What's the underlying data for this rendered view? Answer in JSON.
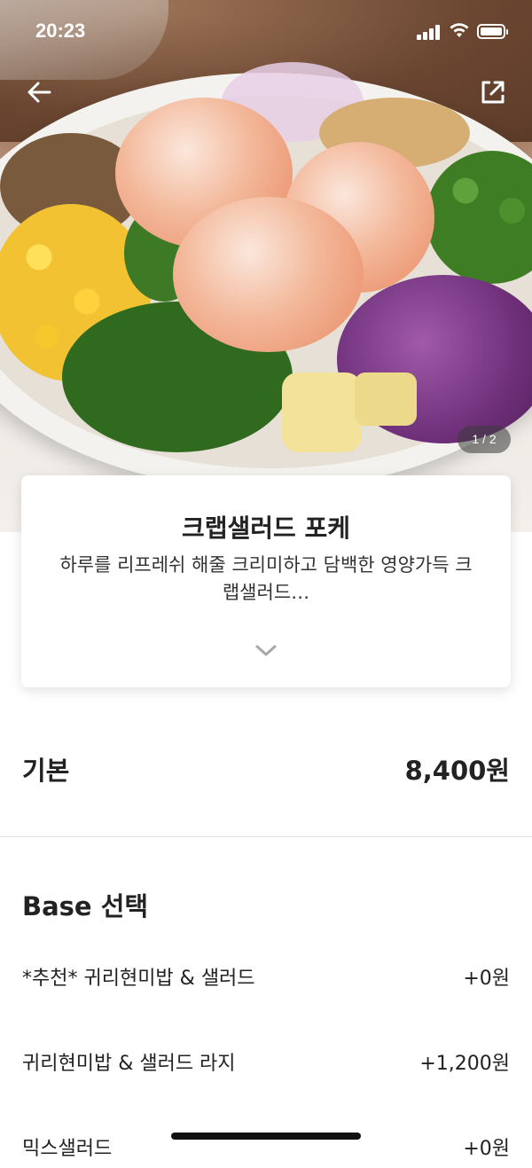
{
  "status_bar": {
    "time": "20:23"
  },
  "gallery": {
    "counter": "1 / 2"
  },
  "product": {
    "name": "크랩샐러드 포케",
    "description": "하루를 리프레쉬 해줄 크리미하고 담백한 영양가득 크랩샐러드…"
  },
  "basic": {
    "label": "기본",
    "price": "8,400원"
  },
  "base_section": {
    "title": "Base 선택",
    "options": [
      {
        "label": "*추천* 귀리현미밥 & 샐러드",
        "price": "+0원"
      },
      {
        "label": "귀리현미밥 & 샐러드 라지",
        "price": "+1,200원"
      },
      {
        "label": "믹스샐러드",
        "price": "+0원"
      }
    ]
  },
  "icons": {
    "back": "arrow-left-icon",
    "share": "share-icon",
    "expand": "chevron-down-icon"
  }
}
